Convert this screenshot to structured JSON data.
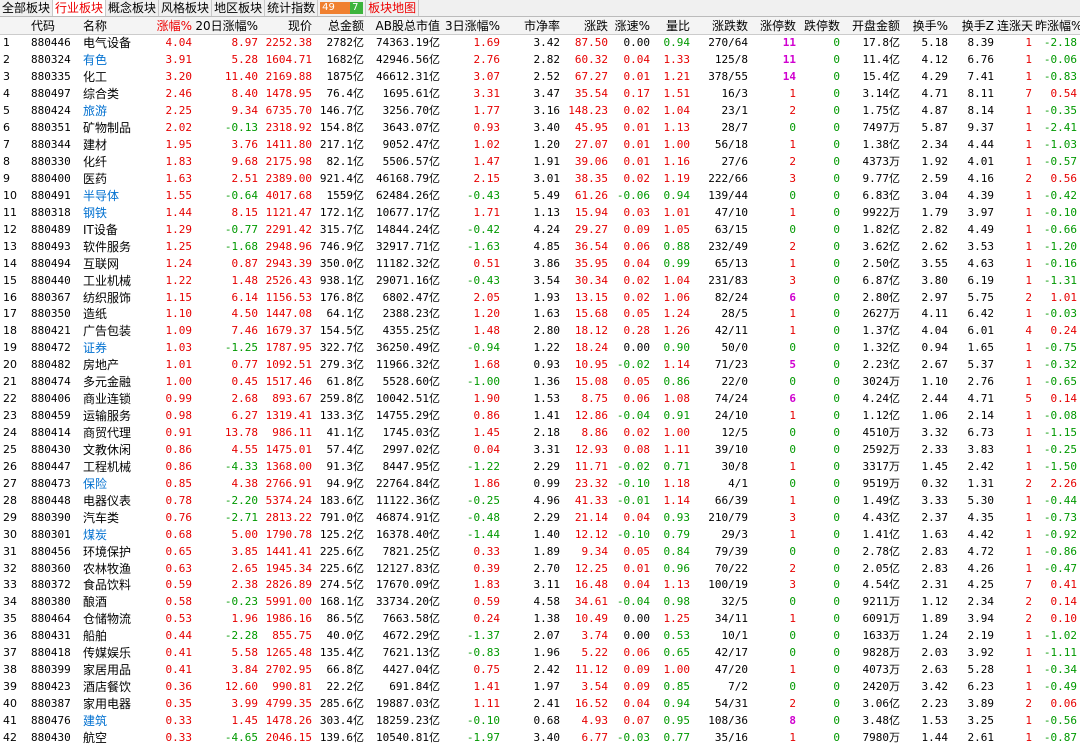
{
  "tabs": [
    {
      "label": "全部板块",
      "state": "normal"
    },
    {
      "label": "行业板块",
      "state": "active"
    },
    {
      "label": "概念板块",
      "state": "normal"
    },
    {
      "label": "风格板块",
      "state": "normal"
    },
    {
      "label": "地区板块",
      "state": "normal"
    },
    {
      "label": "统计指数",
      "state": "normal"
    }
  ],
  "stat_bar": {
    "up": "49",
    "down": "7"
  },
  "map_tab": "板块地图",
  "headers": [
    "",
    "代码",
    "名称",
    "涨幅%",
    "20日涨幅%",
    "现价",
    "总金额",
    "AB股总市值",
    "3日涨幅%",
    "市净率",
    "涨跌",
    "涨速%",
    "量比",
    "涨跌数",
    "涨停数",
    "跌停数",
    "开盘金额",
    "换手%",
    "换手Z",
    "连涨天",
    "昨涨幅%"
  ],
  "sort_column": "涨幅%",
  "colors": {
    "up": "#e60000",
    "down": "#009900",
    "highlight_name": "#0070d0"
  },
  "rows": [
    [
      "1",
      "880446",
      "电气设备",
      "4.04",
      "8.97",
      "2252.38",
      "2782亿",
      "74363.19亿",
      "1.69",
      "3.42",
      "87.50",
      "0.00",
      "0.94",
      "270/64",
      "11",
      "0",
      "17.8亿",
      "5.18",
      "8.39",
      "1",
      "-2.18"
    ],
    [
      "2",
      "880324",
      "有色",
      "3.91",
      "5.28",
      "1604.71",
      "1682亿",
      "42946.56亿",
      "2.76",
      "2.82",
      "60.32",
      "0.04",
      "1.33",
      "125/8",
      "11",
      "0",
      "11.4亿",
      "4.12",
      "6.76",
      "1",
      "-0.06"
    ],
    [
      "3",
      "880335",
      "化工",
      "3.20",
      "11.40",
      "2169.88",
      "1875亿",
      "46612.31亿",
      "3.07",
      "2.52",
      "67.27",
      "0.01",
      "1.21",
      "378/55",
      "14",
      "0",
      "15.4亿",
      "4.29",
      "7.41",
      "1",
      "-0.83"
    ],
    [
      "4",
      "880497",
      "综合类",
      "2.46",
      "8.40",
      "1478.95",
      "76.4亿",
      "1695.61亿",
      "3.31",
      "3.47",
      "35.54",
      "0.17",
      "1.51",
      "16/3",
      "1",
      "0",
      "3.14亿",
      "4.71",
      "8.11",
      "7",
      "0.54"
    ],
    [
      "5",
      "880424",
      "旅游",
      "2.25",
      "9.34",
      "6735.70",
      "146.7亿",
      "3256.70亿",
      "1.77",
      "3.16",
      "148.23",
      "0.02",
      "1.04",
      "23/1",
      "2",
      "0",
      "1.75亿",
      "4.87",
      "8.14",
      "1",
      "-0.35"
    ],
    [
      "6",
      "880351",
      "矿物制品",
      "2.02",
      "-0.13",
      "2318.92",
      "154.8亿",
      "3643.07亿",
      "0.93",
      "3.40",
      "45.95",
      "0.01",
      "1.13",
      "28/7",
      "0",
      "0",
      "7497万",
      "5.87",
      "9.37",
      "1",
      "-2.41"
    ],
    [
      "7",
      "880344",
      "建材",
      "1.95",
      "3.76",
      "1411.80",
      "217.1亿",
      "9052.47亿",
      "1.02",
      "1.20",
      "27.07",
      "0.01",
      "1.00",
      "56/18",
      "1",
      "0",
      "1.38亿",
      "2.34",
      "4.44",
      "1",
      "-1.03"
    ],
    [
      "8",
      "880330",
      "化纤",
      "1.83",
      "9.68",
      "2175.98",
      "82.1亿",
      "5506.57亿",
      "1.47",
      "1.91",
      "39.06",
      "0.01",
      "1.16",
      "27/6",
      "2",
      "0",
      "4373万",
      "1.92",
      "4.01",
      "1",
      "-0.57"
    ],
    [
      "9",
      "880400",
      "医药",
      "1.63",
      "2.51",
      "2389.00",
      "921.4亿",
      "46168.79亿",
      "2.15",
      "3.01",
      "38.35",
      "0.02",
      "1.19",
      "222/66",
      "3",
      "0",
      "9.77亿",
      "2.59",
      "4.16",
      "2",
      "0.56"
    ],
    [
      "10",
      "880491",
      "半导体",
      "1.55",
      "-0.64",
      "4017.68",
      "1559亿",
      "62484.26亿",
      "-0.43",
      "5.49",
      "61.26",
      "-0.06",
      "0.94",
      "139/44",
      "0",
      "0",
      "6.83亿",
      "3.04",
      "4.39",
      "1",
      "-0.42"
    ],
    [
      "11",
      "880318",
      "钢铁",
      "1.44",
      "8.15",
      "1121.47",
      "172.1亿",
      "10677.17亿",
      "1.71",
      "1.13",
      "15.94",
      "0.03",
      "1.01",
      "47/10",
      "1",
      "0",
      "9922万",
      "1.79",
      "3.97",
      "1",
      "-0.10"
    ],
    [
      "12",
      "880489",
      "IT设备",
      "1.29",
      "-0.77",
      "2291.42",
      "315.7亿",
      "14844.24亿",
      "-0.42",
      "4.24",
      "29.27",
      "0.09",
      "1.05",
      "63/15",
      "0",
      "0",
      "1.82亿",
      "2.82",
      "4.49",
      "1",
      "-0.66"
    ],
    [
      "13",
      "880493",
      "软件服务",
      "1.25",
      "-1.68",
      "2948.96",
      "746.9亿",
      "32917.71亿",
      "-1.63",
      "4.85",
      "36.54",
      "0.06",
      "0.88",
      "232/49",
      "2",
      "0",
      "3.62亿",
      "2.62",
      "3.53",
      "1",
      "-1.20"
    ],
    [
      "14",
      "880494",
      "互联网",
      "1.24",
      "0.87",
      "2943.39",
      "350.0亿",
      "11182.32亿",
      "0.51",
      "3.86",
      "35.95",
      "0.04",
      "0.99",
      "65/13",
      "1",
      "0",
      "2.50亿",
      "3.55",
      "4.63",
      "1",
      "-0.16"
    ],
    [
      "15",
      "880440",
      "工业机械",
      "1.22",
      "1.48",
      "2526.43",
      "938.1亿",
      "29071.16亿",
      "-0.43",
      "3.54",
      "30.34",
      "0.02",
      "1.04",
      "231/83",
      "3",
      "0",
      "6.87亿",
      "3.80",
      "6.19",
      "1",
      "-1.31"
    ],
    [
      "16",
      "880367",
      "纺织服饰",
      "1.15",
      "6.14",
      "1156.53",
      "176.8亿",
      "6802.47亿",
      "2.05",
      "1.93",
      "13.15",
      "0.02",
      "1.06",
      "82/24",
      "6",
      "0",
      "2.80亿",
      "2.97",
      "5.75",
      "2",
      "1.01"
    ],
    [
      "17",
      "880350",
      "造纸",
      "1.10",
      "4.50",
      "1447.08",
      "64.1亿",
      "2388.23亿",
      "1.20",
      "1.63",
      "15.68",
      "0.05",
      "1.24",
      "28/5",
      "1",
      "0",
      "2627万",
      "4.11",
      "6.42",
      "1",
      "-0.03"
    ],
    [
      "18",
      "880421",
      "广告包装",
      "1.09",
      "7.46",
      "1679.37",
      "154.5亿",
      "4355.25亿",
      "1.48",
      "2.80",
      "18.12",
      "0.28",
      "1.26",
      "42/11",
      "1",
      "0",
      "1.37亿",
      "4.04",
      "6.01",
      "4",
      "0.24"
    ],
    [
      "19",
      "880472",
      "证券",
      "1.03",
      "-1.25",
      "1787.95",
      "322.7亿",
      "36250.49亿",
      "-0.94",
      "1.22",
      "18.24",
      "0.00",
      "0.90",
      "50/0",
      "0",
      "0",
      "1.32亿",
      "0.94",
      "1.65",
      "1",
      "-0.75"
    ],
    [
      "20",
      "880482",
      "房地产",
      "1.01",
      "0.77",
      "1092.51",
      "279.3亿",
      "11966.32亿",
      "1.68",
      "0.93",
      "10.95",
      "-0.02",
      "1.14",
      "71/23",
      "5",
      "0",
      "2.23亿",
      "2.67",
      "5.37",
      "1",
      "-0.32"
    ],
    [
      "21",
      "880474",
      "多元金融",
      "1.00",
      "0.45",
      "1517.46",
      "61.8亿",
      "5528.60亿",
      "-1.00",
      "1.36",
      "15.08",
      "0.05",
      "0.86",
      "22/0",
      "0",
      "0",
      "3024万",
      "1.10",
      "2.76",
      "1",
      "-0.65"
    ],
    [
      "22",
      "880406",
      "商业连锁",
      "0.99",
      "2.68",
      "893.67",
      "259.8亿",
      "10042.51亿",
      "1.90",
      "1.53",
      "8.75",
      "0.06",
      "1.08",
      "74/24",
      "6",
      "0",
      "4.24亿",
      "2.44",
      "4.71",
      "5",
      "0.14"
    ],
    [
      "23",
      "880459",
      "运输服务",
      "0.98",
      "6.27",
      "1319.41",
      "133.3亿",
      "14755.29亿",
      "0.86",
      "1.41",
      "12.86",
      "-0.04",
      "0.91",
      "24/10",
      "1",
      "0",
      "1.12亿",
      "1.06",
      "2.14",
      "1",
      "-0.08"
    ],
    [
      "24",
      "880414",
      "商贸代理",
      "0.91",
      "13.78",
      "986.11",
      "41.1亿",
      "1745.03亿",
      "1.45",
      "2.18",
      "8.86",
      "0.02",
      "1.00",
      "12/5",
      "0",
      "0",
      "4510万",
      "3.32",
      "6.73",
      "1",
      "-1.15"
    ],
    [
      "25",
      "880430",
      "文教休闲",
      "0.86",
      "4.55",
      "1475.01",
      "57.4亿",
      "2997.02亿",
      "0.04",
      "3.31",
      "12.93",
      "0.08",
      "1.11",
      "39/10",
      "0",
      "0",
      "2592万",
      "2.33",
      "3.83",
      "1",
      "-0.25"
    ],
    [
      "26",
      "880447",
      "工程机械",
      "0.86",
      "-4.33",
      "1368.00",
      "91.3亿",
      "8447.95亿",
      "-1.22",
      "2.29",
      "11.71",
      "-0.02",
      "0.71",
      "30/8",
      "1",
      "0",
      "3317万",
      "1.45",
      "2.42",
      "1",
      "-1.50"
    ],
    [
      "27",
      "880473",
      "保险",
      "0.85",
      "4.38",
      "2766.91",
      "94.9亿",
      "22764.84亿",
      "1.86",
      "0.99",
      "23.32",
      "-0.10",
      "1.18",
      "4/1",
      "0",
      "0",
      "9519万",
      "0.32",
      "1.31",
      "2",
      "2.26"
    ],
    [
      "28",
      "880448",
      "电器仪表",
      "0.78",
      "-2.20",
      "5374.24",
      "183.6亿",
      "11122.36亿",
      "-0.25",
      "4.96",
      "41.33",
      "-0.01",
      "1.14",
      "66/39",
      "1",
      "0",
      "1.49亿",
      "3.33",
      "5.30",
      "1",
      "-0.44"
    ],
    [
      "29",
      "880390",
      "汽车类",
      "0.76",
      "-2.71",
      "2813.22",
      "791.0亿",
      "46874.91亿",
      "-0.48",
      "2.29",
      "21.14",
      "0.04",
      "0.93",
      "210/79",
      "3",
      "0",
      "4.43亿",
      "2.37",
      "4.35",
      "1",
      "-0.73"
    ],
    [
      "30",
      "880301",
      "煤炭",
      "0.68",
      "5.00",
      "1790.78",
      "125.2亿",
      "16378.40亿",
      "-1.44",
      "1.40",
      "12.12",
      "-0.10",
      "0.79",
      "29/3",
      "1",
      "0",
      "1.41亿",
      "1.63",
      "4.42",
      "1",
      "-0.92"
    ],
    [
      "31",
      "880456",
      "环境保护",
      "0.65",
      "3.85",
      "1441.41",
      "225.6亿",
      "7821.25亿",
      "0.33",
      "1.89",
      "9.34",
      "0.05",
      "0.84",
      "79/39",
      "0",
      "0",
      "2.78亿",
      "2.83",
      "4.72",
      "1",
      "-0.86"
    ],
    [
      "32",
      "880360",
      "农林牧渔",
      "0.63",
      "2.65",
      "1945.34",
      "225.6亿",
      "12127.83亿",
      "0.39",
      "2.70",
      "12.25",
      "0.01",
      "0.96",
      "70/22",
      "2",
      "0",
      "2.05亿",
      "2.83",
      "4.26",
      "1",
      "-0.47"
    ],
    [
      "33",
      "880372",
      "食品饮料",
      "0.59",
      "2.38",
      "2826.89",
      "274.5亿",
      "17670.09亿",
      "1.83",
      "3.11",
      "16.48",
      "0.04",
      "1.13",
      "100/19",
      "3",
      "0",
      "4.54亿",
      "2.31",
      "4.25",
      "7",
      "0.41"
    ],
    [
      "34",
      "880380",
      "酿酒",
      "0.58",
      "-0.23",
      "5991.00",
      "168.1亿",
      "33734.20亿",
      "0.59",
      "4.58",
      "34.61",
      "-0.04",
      "0.98",
      "32/5",
      "0",
      "0",
      "9211万",
      "1.12",
      "2.34",
      "2",
      "0.14"
    ],
    [
      "35",
      "880464",
      "仓储物流",
      "0.53",
      "1.96",
      "1986.16",
      "86.5亿",
      "7663.58亿",
      "0.24",
      "1.38",
      "10.49",
      "0.00",
      "1.25",
      "34/11",
      "1",
      "0",
      "6091万",
      "1.89",
      "3.94",
      "2",
      "0.10"
    ],
    [
      "36",
      "880431",
      "船舶",
      "0.44",
      "-2.28",
      "855.75",
      "40.0亿",
      "4672.29亿",
      "-1.37",
      "2.07",
      "3.74",
      "0.00",
      "0.53",
      "10/1",
      "0",
      "0",
      "1633万",
      "1.24",
      "2.19",
      "1",
      "-1.02"
    ],
    [
      "37",
      "880418",
      "传媒娱乐",
      "0.41",
      "5.58",
      "1265.48",
      "135.4亿",
      "7621.13亿",
      "-0.83",
      "1.96",
      "5.22",
      "0.06",
      "0.65",
      "42/17",
      "0",
      "0",
      "9828万",
      "2.03",
      "3.92",
      "1",
      "-1.11"
    ],
    [
      "38",
      "880399",
      "家居用品",
      "0.41",
      "3.84",
      "2702.95",
      "66.8亿",
      "4427.04亿",
      "0.75",
      "2.42",
      "11.12",
      "0.09",
      "1.00",
      "47/20",
      "1",
      "0",
      "4073万",
      "2.63",
      "5.28",
      "1",
      "-0.34"
    ],
    [
      "39",
      "880423",
      "酒店餐饮",
      "0.36",
      "12.60",
      "990.81",
      "22.2亿",
      "691.84亿",
      "1.41",
      "1.97",
      "3.54",
      "0.09",
      "0.85",
      "7/2",
      "0",
      "0",
      "2420万",
      "3.42",
      "6.23",
      "1",
      "-0.49"
    ],
    [
      "40",
      "880387",
      "家用电器",
      "0.35",
      "3.99",
      "4799.35",
      "285.6亿",
      "19887.03亿",
      "1.11",
      "2.41",
      "16.52",
      "0.04",
      "0.94",
      "54/31",
      "2",
      "0",
      "3.06亿",
      "2.23",
      "3.89",
      "2",
      "0.06"
    ],
    [
      "41",
      "880476",
      "建筑",
      "0.33",
      "1.45",
      "1478.26",
      "303.4亿",
      "18259.23亿",
      "-0.10",
      "0.68",
      "4.93",
      "0.07",
      "0.95",
      "108/36",
      "8",
      "0",
      "3.48亿",
      "1.53",
      "3.25",
      "1",
      "-0.56"
    ],
    [
      "42",
      "880430",
      "航空",
      "0.33",
      "-4.65",
      "2046.15",
      "139.6亿",
      "10540.81亿",
      "-1.97",
      "3.40",
      "6.77",
      "-0.03",
      "0.77",
      "35/16",
      "1",
      "0",
      "7980万",
      "1.44",
      "2.61",
      "1",
      "-0.87"
    ]
  ],
  "blue_names": [
    "有色",
    "旅游",
    "半导体",
    "钢铁",
    "证券",
    "保险",
    "煤炭",
    "建筑"
  ]
}
